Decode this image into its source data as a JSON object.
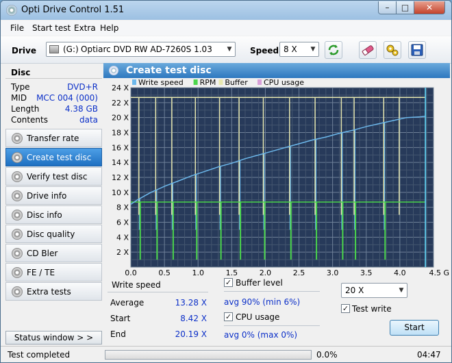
{
  "window": {
    "title": "Opti Drive Control 1.51",
    "min_label": "–",
    "max_label": "□",
    "close_label": "✕"
  },
  "menu": [
    "File",
    "Start test",
    "Extra",
    "Help"
  ],
  "toolbar": {
    "drive_label": "Drive",
    "drive_letter": "(G:)",
    "drive_value": "Optiarc DVD RW AD-7260S 1.03",
    "speed_label": "Speed",
    "speed_value": "8 X"
  },
  "disc": {
    "heading": "Disc",
    "rows": [
      {
        "key": "Type",
        "value": "DVD+R"
      },
      {
        "key": "MID",
        "value": "MCC 004 (000)"
      },
      {
        "key": "Length",
        "value": "4.38 GB"
      },
      {
        "key": "Contents",
        "value": "data"
      }
    ]
  },
  "nav": [
    {
      "label": "Transfer rate",
      "active": false
    },
    {
      "label": "Create test disc",
      "active": true
    },
    {
      "label": "Verify test disc",
      "active": false
    },
    {
      "label": "Drive info",
      "active": false
    },
    {
      "label": "Disc info",
      "active": false
    },
    {
      "label": "Disc quality",
      "active": false
    },
    {
      "label": "CD Bler",
      "active": false
    },
    {
      "label": "FE / TE",
      "active": false
    },
    {
      "label": "Extra tests",
      "active": false
    }
  ],
  "status_window_label": "Status window > >",
  "panel": {
    "title": "Create test disc"
  },
  "chart_data": {
    "type": "line",
    "legend_position": "top-left",
    "legend": [
      {
        "name": "Write speed",
        "color": "#6cb8ec"
      },
      {
        "name": "RPM",
        "color": "#4bd64b"
      },
      {
        "name": "Buffer",
        "color": "#e8e8b0"
      },
      {
        "name": "CPU usage",
        "color": "#d8a0d8"
      }
    ],
    "xlim": [
      0,
      4.5
    ],
    "ylim": [
      0,
      24
    ],
    "x_ticks": [
      "0.0",
      "0.5",
      "1.0",
      "1.5",
      "2.0",
      "2.5",
      "3.0",
      "3.5",
      "4.0",
      "4.5 GB"
    ],
    "y_ticks": [
      "2 X",
      "4 X",
      "6 X",
      "8 X",
      "10 X",
      "12 X",
      "14 X",
      "16 X",
      "18 X",
      "20 X",
      "22 X",
      "24 X"
    ],
    "grid": true,
    "background": "#273a5a",
    "end_marker_x": 4.38,
    "series": [
      {
        "name": "Write speed",
        "color": "#6cb8ec",
        "x": [
          0.0,
          0.1,
          0.2,
          0.3,
          0.4,
          0.5,
          0.7,
          0.9,
          1.1,
          1.3,
          1.5,
          1.7,
          1.9,
          2.1,
          2.3,
          2.5,
          2.7,
          2.9,
          3.1,
          3.3,
          3.5,
          3.7,
          3.9,
          4.1,
          4.3,
          4.38
        ],
        "y": [
          8.4,
          9.0,
          9.5,
          10.0,
          10.4,
          10.8,
          11.5,
          12.2,
          12.8,
          13.4,
          13.9,
          14.5,
          15.0,
          15.5,
          16.0,
          16.5,
          17.0,
          17.4,
          17.9,
          18.3,
          18.8,
          19.2,
          19.6,
          20.0,
          20.1,
          20.19
        ]
      },
      {
        "name": "RPM",
        "color": "#4bd64b",
        "x": [
          0.0,
          4.38
        ],
        "y": [
          8.7,
          8.7
        ]
      },
      {
        "name": "Buffer",
        "color": "#e8e8b0",
        "x": [
          0.0,
          4.38
        ],
        "y": [
          22.7,
          22.7
        ]
      }
    ],
    "buffer_drop_x": [
      0.13,
      0.38,
      0.62,
      0.97,
      1.33,
      1.62,
      1.98,
      2.37,
      2.75,
      3.14,
      3.33,
      3.77,
      4.0
    ],
    "speed_drop_x": [
      0.13,
      0.38,
      0.62,
      0.97,
      1.33,
      1.62,
      1.98,
      2.37,
      2.75,
      3.14,
      3.33,
      3.77
    ]
  },
  "stats": {
    "write_speed_heading": "Write speed",
    "average_label": "Average",
    "average_value": "13.28 X",
    "start_label": "Start",
    "start_value": "8.42 X",
    "end_label": "End",
    "end_value": "20.19 X",
    "buffer_level_label": "Buffer level",
    "buffer_level_value": "avg 90% (min 6%)",
    "cpu_usage_label": "CPU usage",
    "cpu_usage_value": "avg 0% (max 0%)",
    "speed_select_value": "20 X",
    "test_write_label": "Test write",
    "start_button": "Start",
    "check_mark": "✓"
  },
  "status": {
    "text": "Test completed",
    "progress_percent": 0,
    "progress_label": "0.0%",
    "time": "04:47"
  }
}
